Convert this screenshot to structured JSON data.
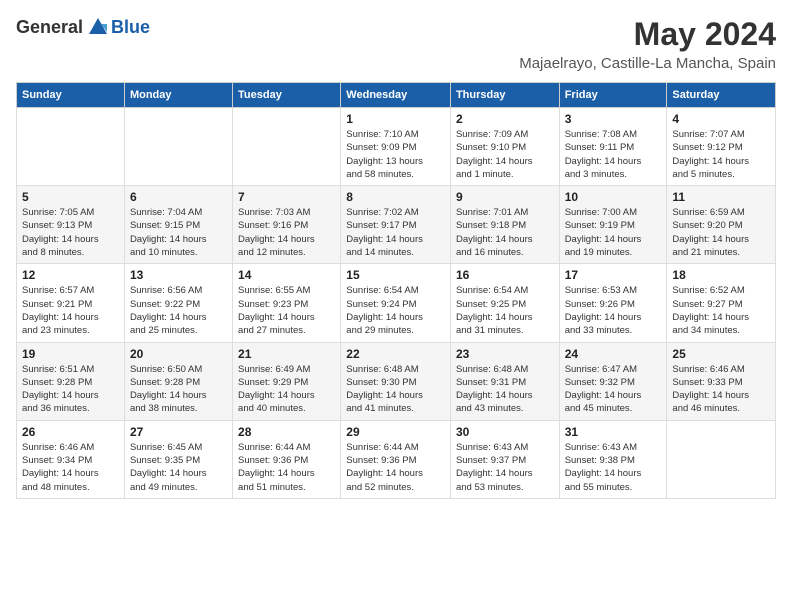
{
  "header": {
    "logo_general": "General",
    "logo_blue": "Blue",
    "month_title": "May 2024",
    "location": "Majaelrayo, Castille-La Mancha, Spain"
  },
  "weekdays": [
    "Sunday",
    "Monday",
    "Tuesday",
    "Wednesday",
    "Thursday",
    "Friday",
    "Saturday"
  ],
  "weeks": [
    [
      {
        "day": "",
        "info": ""
      },
      {
        "day": "",
        "info": ""
      },
      {
        "day": "",
        "info": ""
      },
      {
        "day": "1",
        "info": "Sunrise: 7:10 AM\nSunset: 9:09 PM\nDaylight: 13 hours\nand 58 minutes."
      },
      {
        "day": "2",
        "info": "Sunrise: 7:09 AM\nSunset: 9:10 PM\nDaylight: 14 hours\nand 1 minute."
      },
      {
        "day": "3",
        "info": "Sunrise: 7:08 AM\nSunset: 9:11 PM\nDaylight: 14 hours\nand 3 minutes."
      },
      {
        "day": "4",
        "info": "Sunrise: 7:07 AM\nSunset: 9:12 PM\nDaylight: 14 hours\nand 5 minutes."
      }
    ],
    [
      {
        "day": "5",
        "info": "Sunrise: 7:05 AM\nSunset: 9:13 PM\nDaylight: 14 hours\nand 8 minutes."
      },
      {
        "day": "6",
        "info": "Sunrise: 7:04 AM\nSunset: 9:15 PM\nDaylight: 14 hours\nand 10 minutes."
      },
      {
        "day": "7",
        "info": "Sunrise: 7:03 AM\nSunset: 9:16 PM\nDaylight: 14 hours\nand 12 minutes."
      },
      {
        "day": "8",
        "info": "Sunrise: 7:02 AM\nSunset: 9:17 PM\nDaylight: 14 hours\nand 14 minutes."
      },
      {
        "day": "9",
        "info": "Sunrise: 7:01 AM\nSunset: 9:18 PM\nDaylight: 14 hours\nand 16 minutes."
      },
      {
        "day": "10",
        "info": "Sunrise: 7:00 AM\nSunset: 9:19 PM\nDaylight: 14 hours\nand 19 minutes."
      },
      {
        "day": "11",
        "info": "Sunrise: 6:59 AM\nSunset: 9:20 PM\nDaylight: 14 hours\nand 21 minutes."
      }
    ],
    [
      {
        "day": "12",
        "info": "Sunrise: 6:57 AM\nSunset: 9:21 PM\nDaylight: 14 hours\nand 23 minutes."
      },
      {
        "day": "13",
        "info": "Sunrise: 6:56 AM\nSunset: 9:22 PM\nDaylight: 14 hours\nand 25 minutes."
      },
      {
        "day": "14",
        "info": "Sunrise: 6:55 AM\nSunset: 9:23 PM\nDaylight: 14 hours\nand 27 minutes."
      },
      {
        "day": "15",
        "info": "Sunrise: 6:54 AM\nSunset: 9:24 PM\nDaylight: 14 hours\nand 29 minutes."
      },
      {
        "day": "16",
        "info": "Sunrise: 6:54 AM\nSunset: 9:25 PM\nDaylight: 14 hours\nand 31 minutes."
      },
      {
        "day": "17",
        "info": "Sunrise: 6:53 AM\nSunset: 9:26 PM\nDaylight: 14 hours\nand 33 minutes."
      },
      {
        "day": "18",
        "info": "Sunrise: 6:52 AM\nSunset: 9:27 PM\nDaylight: 14 hours\nand 34 minutes."
      }
    ],
    [
      {
        "day": "19",
        "info": "Sunrise: 6:51 AM\nSunset: 9:28 PM\nDaylight: 14 hours\nand 36 minutes."
      },
      {
        "day": "20",
        "info": "Sunrise: 6:50 AM\nSunset: 9:28 PM\nDaylight: 14 hours\nand 38 minutes."
      },
      {
        "day": "21",
        "info": "Sunrise: 6:49 AM\nSunset: 9:29 PM\nDaylight: 14 hours\nand 40 minutes."
      },
      {
        "day": "22",
        "info": "Sunrise: 6:48 AM\nSunset: 9:30 PM\nDaylight: 14 hours\nand 41 minutes."
      },
      {
        "day": "23",
        "info": "Sunrise: 6:48 AM\nSunset: 9:31 PM\nDaylight: 14 hours\nand 43 minutes."
      },
      {
        "day": "24",
        "info": "Sunrise: 6:47 AM\nSunset: 9:32 PM\nDaylight: 14 hours\nand 45 minutes."
      },
      {
        "day": "25",
        "info": "Sunrise: 6:46 AM\nSunset: 9:33 PM\nDaylight: 14 hours\nand 46 minutes."
      }
    ],
    [
      {
        "day": "26",
        "info": "Sunrise: 6:46 AM\nSunset: 9:34 PM\nDaylight: 14 hours\nand 48 minutes."
      },
      {
        "day": "27",
        "info": "Sunrise: 6:45 AM\nSunset: 9:35 PM\nDaylight: 14 hours\nand 49 minutes."
      },
      {
        "day": "28",
        "info": "Sunrise: 6:44 AM\nSunset: 9:36 PM\nDaylight: 14 hours\nand 51 minutes."
      },
      {
        "day": "29",
        "info": "Sunrise: 6:44 AM\nSunset: 9:36 PM\nDaylight: 14 hours\nand 52 minutes."
      },
      {
        "day": "30",
        "info": "Sunrise: 6:43 AM\nSunset: 9:37 PM\nDaylight: 14 hours\nand 53 minutes."
      },
      {
        "day": "31",
        "info": "Sunrise: 6:43 AM\nSunset: 9:38 PM\nDaylight: 14 hours\nand 55 minutes."
      },
      {
        "day": "",
        "info": ""
      }
    ]
  ]
}
